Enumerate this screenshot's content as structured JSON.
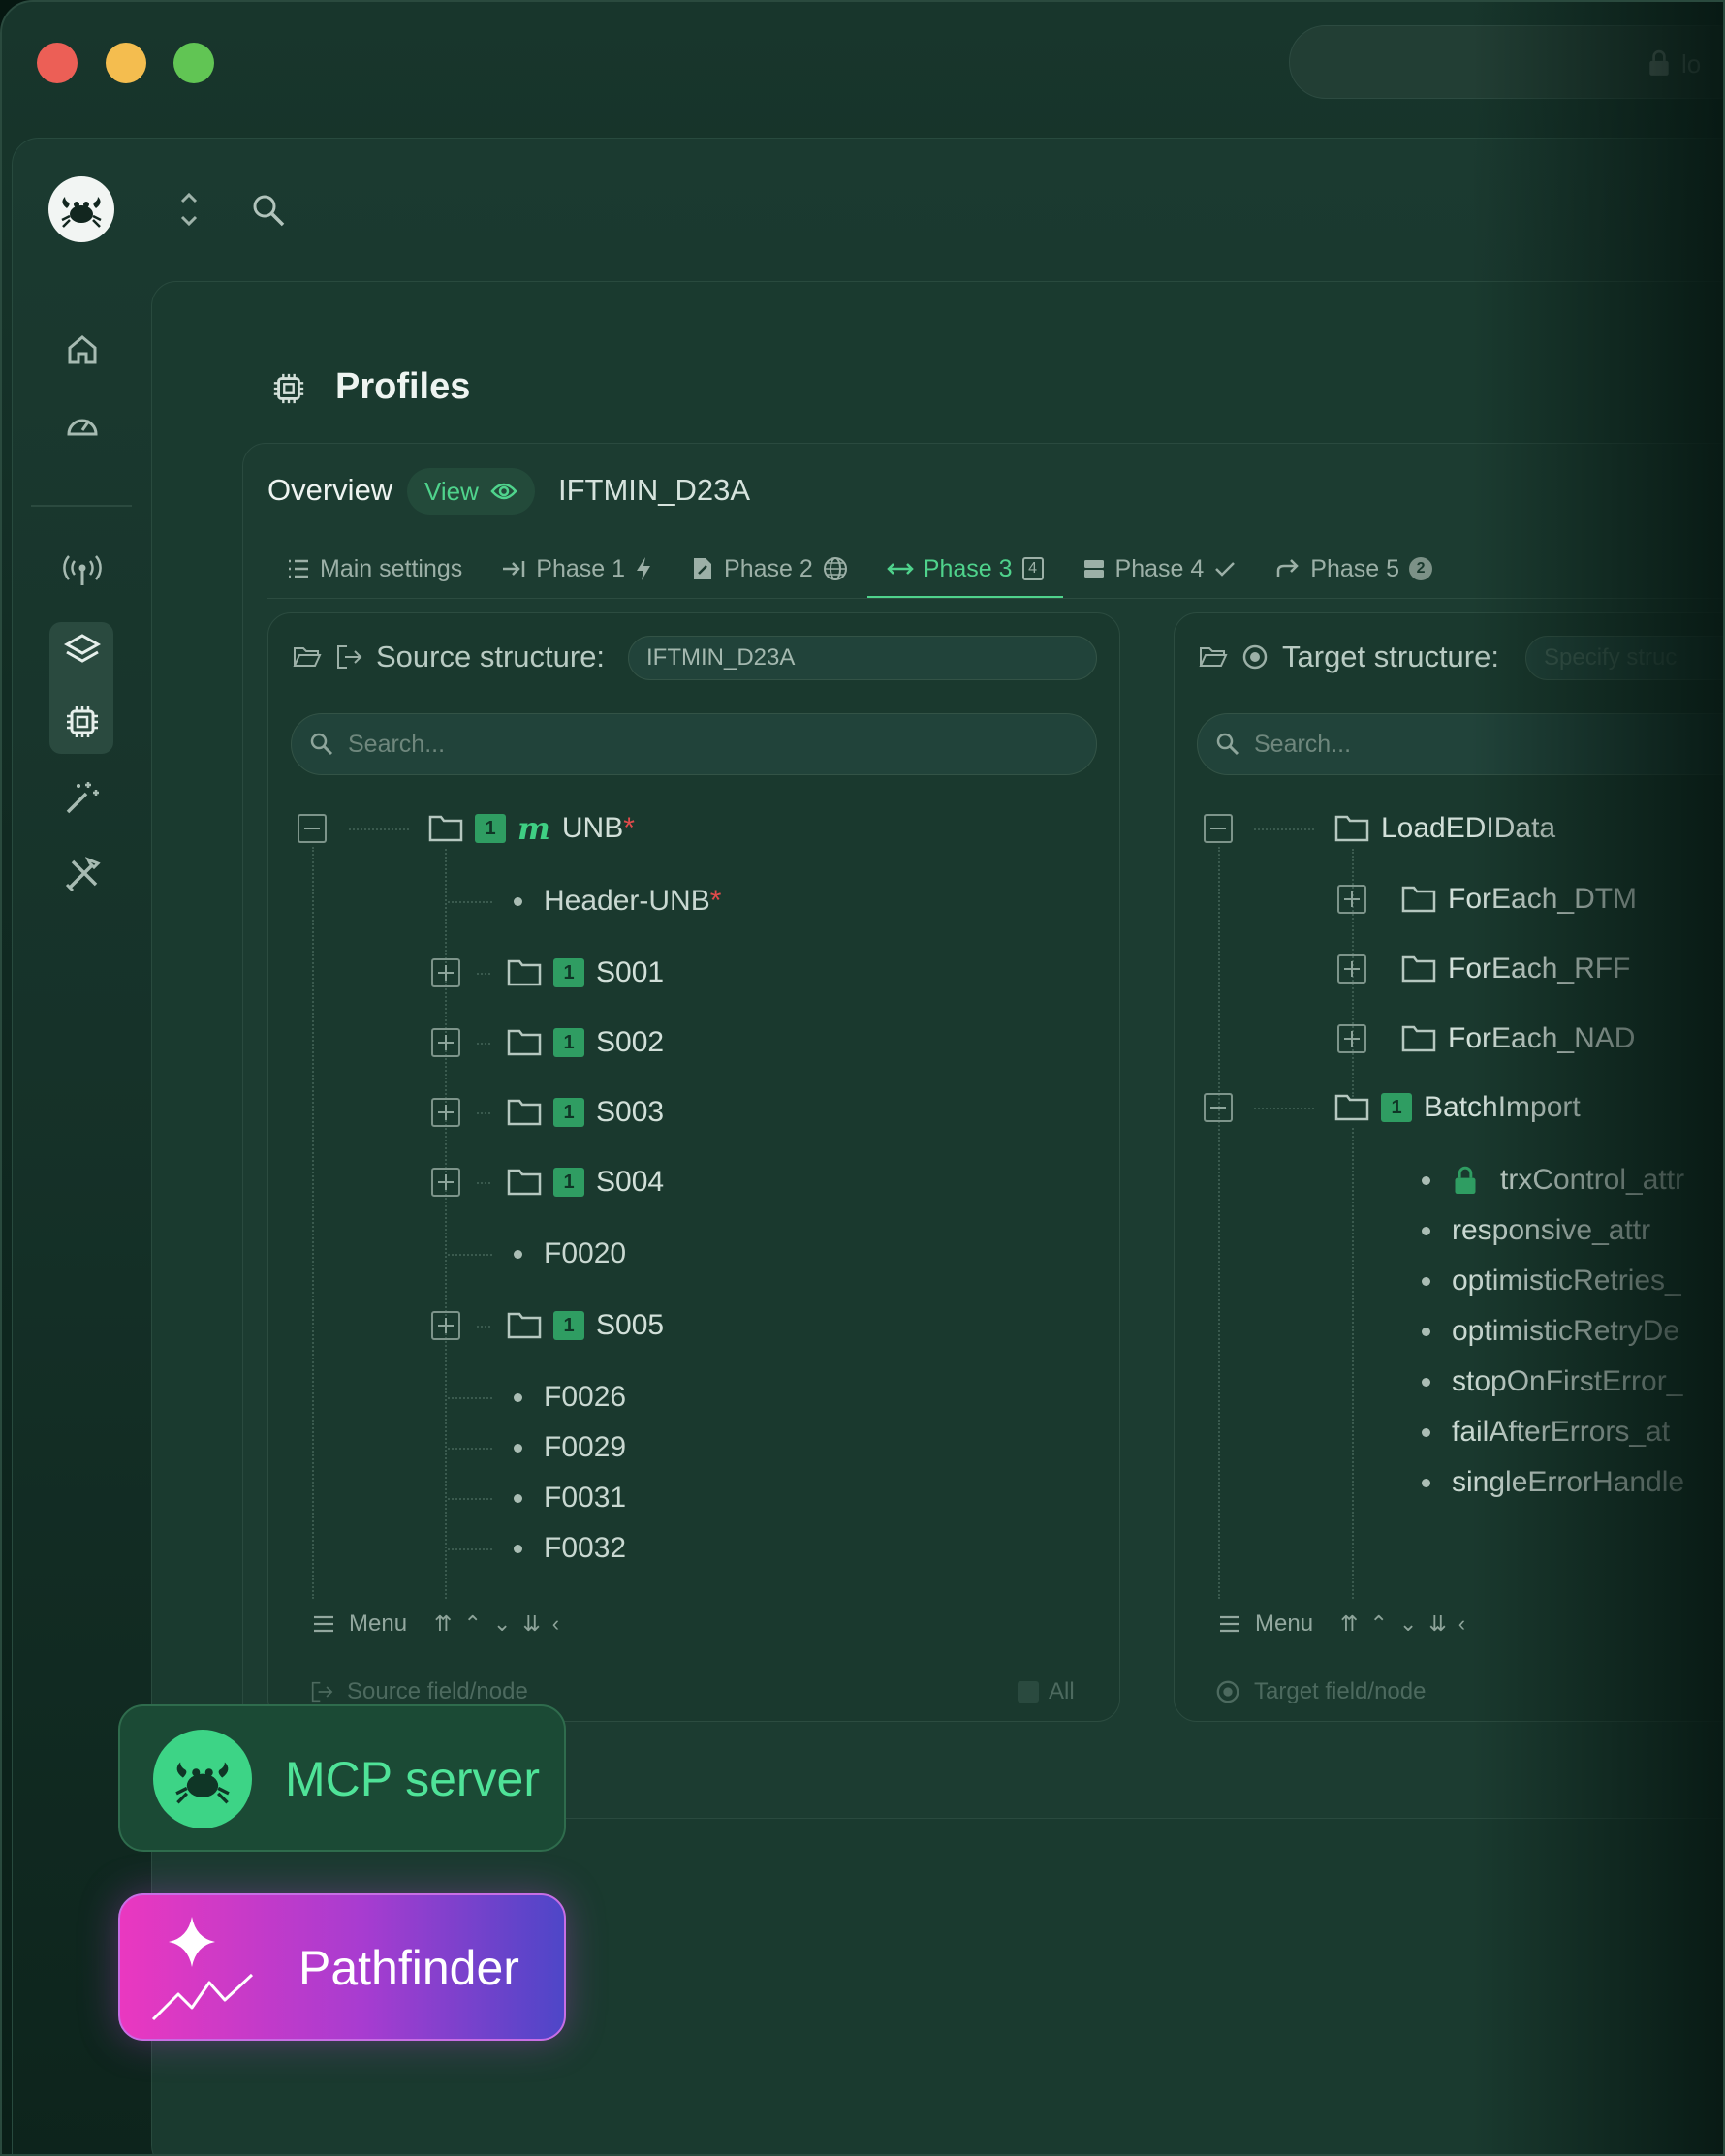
{
  "topbar": {
    "pill_text": "lo"
  },
  "page": {
    "title": "Profiles"
  },
  "header": {
    "overview": "Overview",
    "view_label": "View",
    "profile_name": "IFTMIN_D23A"
  },
  "tabs": [
    {
      "label": "Main settings"
    },
    {
      "label": "Phase 1"
    },
    {
      "label": "Phase 2"
    },
    {
      "label": "Phase 3",
      "badge": "4"
    },
    {
      "label": "Phase 4"
    },
    {
      "label": "Phase 5",
      "badge": "2"
    }
  ],
  "source": {
    "title": "Source structure:",
    "structure_value": "IFTMIN_D23A",
    "search_placeholder": "Search...",
    "root": {
      "badge": "1",
      "mark": "m",
      "label": "UNB",
      "required": "*"
    },
    "header_leaf": {
      "label": "Header-UNB",
      "required": "*"
    },
    "nodes": [
      {
        "badge": "1",
        "label": "S001"
      },
      {
        "badge": "1",
        "label": "S002"
      },
      {
        "badge": "1",
        "label": "S003"
      },
      {
        "badge": "1",
        "label": "S004"
      }
    ],
    "leaf_f0020": "F0020",
    "node_s005": {
      "badge": "1",
      "label": "S005"
    },
    "leaves": [
      "F0026",
      "F0029",
      "F0031",
      "F0032"
    ],
    "menu_label": "Menu",
    "footer_field": "Source field/node",
    "footer_all": "All"
  },
  "target": {
    "title": "Target structure:",
    "structure_placeholder": "Specify struc",
    "search_placeholder": "Search...",
    "root": {
      "label": "LoadEDIData"
    },
    "foreach": [
      {
        "label": "ForEach_DTM"
      },
      {
        "label": "ForEach_RFF"
      },
      {
        "label": "ForEach_NAD"
      }
    ],
    "batch": {
      "badge": "1",
      "label": "BatchImport"
    },
    "attrs": [
      "trxControl_attr",
      "responsive_attr",
      "optimisticRetries_",
      "optimisticRetryDe",
      "stopOnFirstError_",
      "failAfterErrors_at",
      "singleErrorHandle"
    ],
    "menu_label": "Menu",
    "footer_field": "Target field/node"
  },
  "floating": {
    "mcp_label": "MCP server",
    "pathfinder_label": "Pathfinder"
  },
  "colors": {
    "accent": "#4fd38c",
    "background": "#112a22",
    "badge": "#2f9d62",
    "required": "#e04b4b",
    "pathfinder_gradient_start": "#ea38c0",
    "pathfinder_gradient_end": "#4e46c8"
  }
}
